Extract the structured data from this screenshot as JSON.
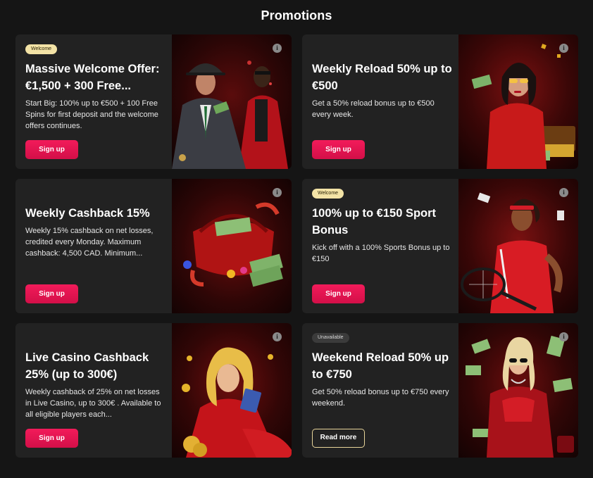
{
  "page": {
    "title": "Promotions"
  },
  "colors": {
    "accent": "#e5124f",
    "badge_gold": "#f3e3a6",
    "badge_gray": "#3b3b3b",
    "card_bg": "#222222",
    "page_bg": "#151515"
  },
  "promotions": [
    {
      "badge": "Welcome",
      "title": "Massive Welcome Offer: €1,500 + 300 Free...",
      "description": "Start Big: 100% up to €500 + 100 Free Spins for first deposit and the welcome offers continues.",
      "button": "Sign up",
      "info_icon": "info-icon",
      "art": "gangster-men-art"
    },
    {
      "title": "Weekly Reload 50% up to €500",
      "description": "Get a 50% reload bonus up to €500 every week.",
      "button": "Sign up",
      "info_icon": "info-icon",
      "art": "woman-with-money-art"
    },
    {
      "title": "Weekly Cashback 15%",
      "description": "Weekly 15% cashback on net losses, credited every Monday. Maximum cashback: 4,500 CAD. Minimum...",
      "button": "Sign up",
      "info_icon": "info-icon",
      "art": "red-bag-cash-art"
    },
    {
      "badge": "Welcome",
      "title": "100% up to €150 Sport Bonus",
      "description": "Kick off with a 100% Sports Bonus up to €150",
      "button": "Sign up",
      "info_icon": "info-icon",
      "art": "tennis-player-art"
    },
    {
      "title": "Live Casino Cashback 25% (up to 300€)",
      "description": "Weekly cashback of 25% on net losses in Live Casino, up to 300€ . Available to all eligible players each...",
      "button": "Sign up",
      "info_icon": "info-icon",
      "art": "blonde-with-cards-art"
    },
    {
      "badge": "Unavailable",
      "title": "Weekend Reload 50% up to €750",
      "description": "Get 50% reload bonus up to €750 every weekend.",
      "button": "Read more",
      "info_icon": "info-icon",
      "art": "woman-in-red-jacket-art"
    }
  ]
}
